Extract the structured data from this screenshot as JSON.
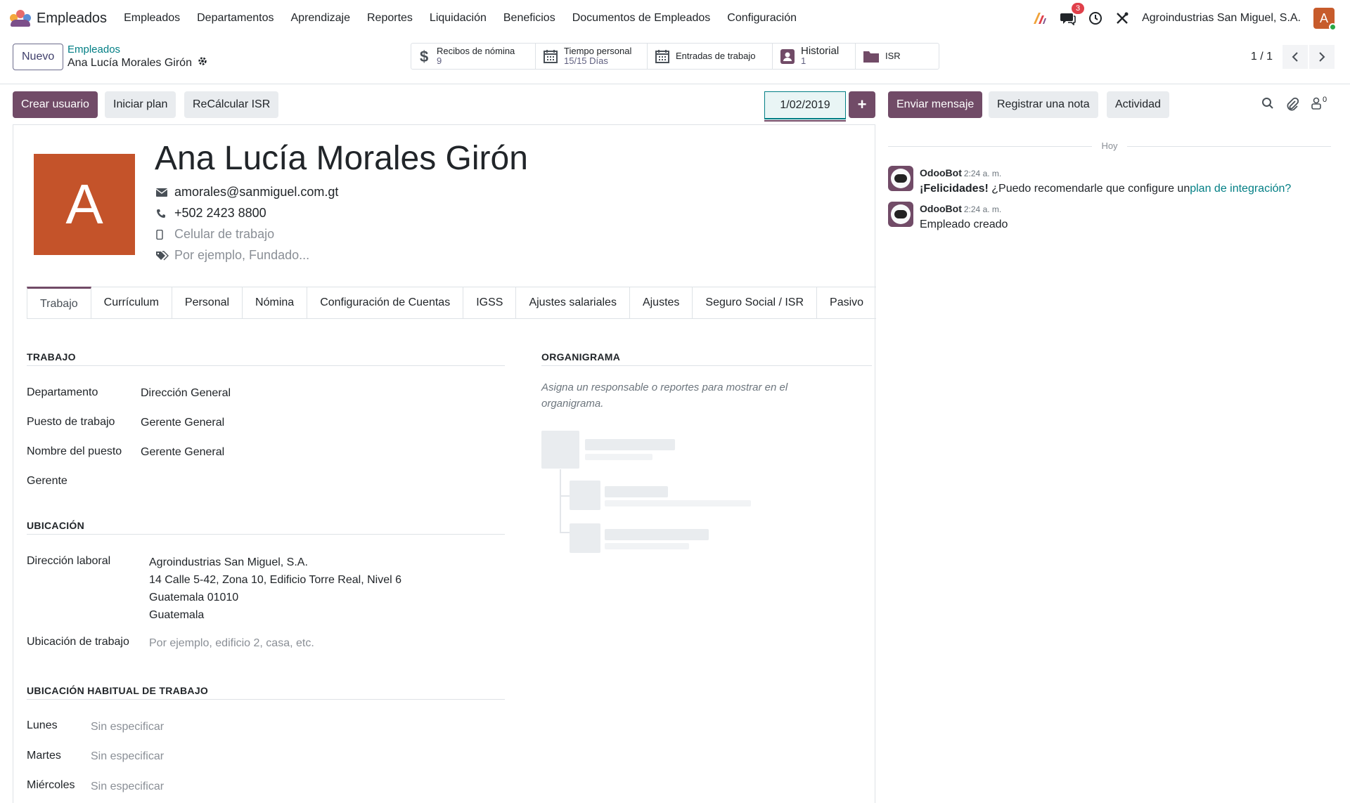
{
  "navbar": {
    "app_name": "Empleados",
    "menu": [
      "Empleados",
      "Departamentos",
      "Aprendizaje",
      "Reportes",
      "Liquidación",
      "Beneficios",
      "Documentos de Empleados",
      "Configuración"
    ],
    "messages_badge": "3",
    "company": "Agroindustrias San Miguel, S.A.",
    "user_initial": "A"
  },
  "control_panel": {
    "new_label": "Nuevo",
    "breadcrumb_parent": "Empleados",
    "breadcrumb_current": "Ana Lucía Morales Girón",
    "pager_value": "1 / 1"
  },
  "smart_buttons": {
    "payslips": {
      "label": "Recibos de nómina",
      "value": "9",
      "icon": "dollar-icon"
    },
    "time_off": {
      "label": "Tiempo personal",
      "value": "15/15 Días",
      "icon": "calendar-icon"
    },
    "work_entries": {
      "label": "Entradas de trabajo",
      "icon": "calendar-icon"
    },
    "history": {
      "label": "Historial",
      "value": "1",
      "icon": "id-card-icon"
    },
    "isr": {
      "label": "ISR",
      "icon": "folder-icon"
    }
  },
  "actions": {
    "create_user": "Crear usuario",
    "start_plan": "Iniciar plan",
    "recalc_isr": "ReCálcular ISR",
    "date_value": "1/02/2019",
    "plus": "+"
  },
  "employee": {
    "initial": "A",
    "name": "Ana Lucía Morales Girón",
    "email": "amorales@sanmiguel.com.gt",
    "phone": "+502 2423 8800",
    "mobile_placeholder": "Celular de trabajo",
    "tags_placeholder": "Por ejemplo, Fundado..."
  },
  "tabs": [
    "Trabajo",
    "Currículum",
    "Personal",
    "Nómina",
    "Configuración de Cuentas",
    "IGSS",
    "Ajustes salariales",
    "Ajustes",
    "Seguro Social / ISR",
    "Pasivo"
  ],
  "work": {
    "section_title": "TRABAJO",
    "department_label": "Departamento",
    "department_value": "Dirección General",
    "job_position_label": "Puesto de trabajo",
    "job_position_value": "Gerente General",
    "job_title_label": "Nombre del puesto",
    "job_title_value": "Gerente General",
    "manager_label": "Gerente"
  },
  "location": {
    "section_title": "UBICACIÓN",
    "address_label": "Dirección laboral",
    "address_lines": [
      "Agroindustrias San Miguel, S.A.",
      "14 Calle 5-42, Zona 10, Edificio Torre Real, Nivel 6",
      "Guatemala 01010",
      "Guatemala"
    ],
    "work_location_label": "Ubicación de trabajo",
    "work_location_placeholder": "Por ejemplo, edificio 2, casa, etc."
  },
  "habitual": {
    "section_title": "UBICACIÓN HABITUAL DE TRABAJO",
    "days": [
      {
        "day": "Lunes",
        "value": "Sin especificar"
      },
      {
        "day": "Martes",
        "value": "Sin especificar"
      },
      {
        "day": "Miércoles",
        "value": "Sin especificar"
      }
    ]
  },
  "org_chart": {
    "section_title": "ORGANIGRAMA",
    "hint": "Asigna un responsable o reportes para mostrar en el organigrama."
  },
  "chatter": {
    "send_message": "Enviar mensaje",
    "log_note": "Registrar una nota",
    "activity": "Actividad",
    "followers_count": "0",
    "today_label": "Hoy",
    "messages": [
      {
        "author": "OdooBot",
        "time": "2:24 a. m.",
        "bold": "¡Felicidades!",
        "text": " ¿Puedo recomendarle que configure un",
        "link": "plan de integración?"
      },
      {
        "author": "OdooBot",
        "time": "2:24 a. m.",
        "text": "Empleado creado"
      }
    ]
  }
}
